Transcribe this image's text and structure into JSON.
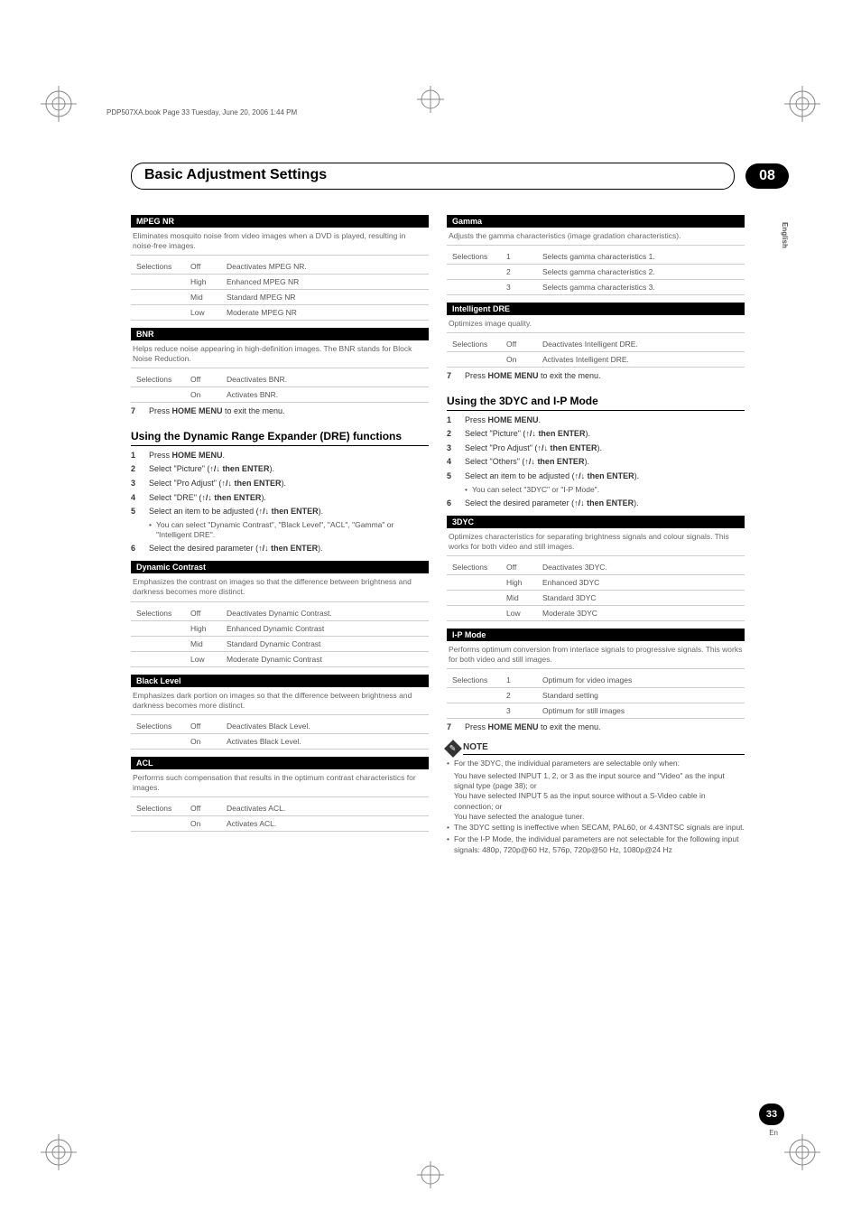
{
  "doc_header": "PDP507XA.book  Page 33  Tuesday, June 20, 2006  1:44 PM",
  "title": "Basic Adjustment Settings",
  "chapter": "08",
  "language_tab": "English",
  "page_number": "33",
  "page_lang": "En",
  "arrows": "↑/↓",
  "sections": {
    "mpeg_nr": {
      "title": "MPEG NR",
      "desc": "Eliminates mosquito noise from video images when a DVD is played, resulting in noise-free images.",
      "sel_label": "Selections",
      "rows": [
        {
          "v": "Off",
          "d": "Deactivates MPEG NR."
        },
        {
          "v": "High",
          "d": "Enhanced MPEG NR"
        },
        {
          "v": "Mid",
          "d": "Standard MPEG NR"
        },
        {
          "v": "Low",
          "d": "Moderate MPEG NR"
        }
      ]
    },
    "bnr": {
      "title": "BNR",
      "desc": "Helps reduce noise appearing in high-definition images. The BNR stands for Block Noise Reduction.",
      "sel_label": "Selections",
      "rows": [
        {
          "v": "Off",
          "d": "Deactivates BNR."
        },
        {
          "v": "On",
          "d": "Activates BNR."
        }
      ]
    },
    "exit1": {
      "num": "7",
      "pre": "Press ",
      "b": "HOME MENU",
      "post": " to exit the menu."
    },
    "dre_head": "Using the Dynamic Range Expander (DRE) functions",
    "dre_steps": [
      {
        "n": "1",
        "pre": "Press ",
        "b": "HOME MENU",
        "post": "."
      },
      {
        "n": "2",
        "pre": "Select \"Picture\" (",
        "b": " then ENTER",
        "post": ")."
      },
      {
        "n": "3",
        "pre": "Select \"Pro Adjust\" (",
        "b": " then ENTER",
        "post": ")."
      },
      {
        "n": "4",
        "pre": "Select \"DRE\" (",
        "b": " then ENTER",
        "post": ")."
      },
      {
        "n": "5",
        "pre": "Select an item to be adjusted (",
        "b": " then ENTER",
        "post": ")."
      },
      {
        "n": "6",
        "pre": "Select the desired parameter (",
        "b": " then ENTER",
        "post": ")."
      }
    ],
    "dre_step5_sub": "You can select \"Dynamic Contrast\", \"Black Level\", \"ACL\", \"Gamma\" or \"Intelligent DRE\".",
    "dyn_contrast": {
      "title": "Dynamic Contrast",
      "desc": "Emphasizes the contrast on images so that the difference between brightness and darkness becomes more distinct.",
      "sel_label": "Selections",
      "rows": [
        {
          "v": "Off",
          "d": "Deactivates Dynamic Contrast."
        },
        {
          "v": "High",
          "d": "Enhanced Dynamic Contrast"
        },
        {
          "v": "Mid",
          "d": "Standard Dynamic Contrast"
        },
        {
          "v": "Low",
          "d": "Moderate Dynamic Contrast"
        }
      ]
    },
    "black_level": {
      "title": "Black Level",
      "desc": "Emphasizes dark portion on images so that the difference between brightness and darkness becomes more distinct.",
      "sel_label": "Selections",
      "rows": [
        {
          "v": "Off",
          "d": "Deactivates Black Level."
        },
        {
          "v": "On",
          "d": "Activates Black Level."
        }
      ]
    },
    "acl": {
      "title": "ACL",
      "desc": "Performs such compensation that results in the optimum contrast characteristics for images.",
      "sel_label": "Selections",
      "rows": [
        {
          "v": "Off",
          "d": "Deactivates ACL."
        },
        {
          "v": "On",
          "d": "Activates ACL."
        }
      ]
    },
    "gamma": {
      "title": "Gamma",
      "desc": "Adjusts the gamma characteristics (image gradation characteristics).",
      "sel_label": "Selections",
      "rows": [
        {
          "v": "1",
          "d": "Selects gamma characteristics 1."
        },
        {
          "v": "2",
          "d": "Selects gamma characteristics 2."
        },
        {
          "v": "3",
          "d": "Selects gamma characteristics 3."
        }
      ]
    },
    "idre": {
      "title": "Intelligent DRE",
      "desc": "Optimizes image quality.",
      "sel_label": "Selections",
      "rows": [
        {
          "v": "Off",
          "d": "Deactivates Intelligent DRE."
        },
        {
          "v": "On",
          "d": "Activates Intelligent DRE."
        }
      ]
    },
    "exit2": {
      "num": "7",
      "pre": "Press ",
      "b": "HOME MENU",
      "post": " to exit the menu."
    },
    "ip_head": "Using the 3DYC and I-P Mode",
    "ip_steps": [
      {
        "n": "1",
        "pre": "Press ",
        "b": "HOME MENU",
        "post": "."
      },
      {
        "n": "2",
        "pre": "Select \"Picture\" (",
        "b": " then ENTER",
        "post": ")."
      },
      {
        "n": "3",
        "pre": "Select \"Pro Adjust\" (",
        "b": " then ENTER",
        "post": ")."
      },
      {
        "n": "4",
        "pre": "Select \"Others\" (",
        "b": " then ENTER",
        "post": ")."
      },
      {
        "n": "5",
        "pre": "Select an item to be adjusted (",
        "b": " then ENTER",
        "post": ")."
      },
      {
        "n": "6",
        "pre": "Select the desired parameter (",
        "b": " then ENTER",
        "post": ")."
      }
    ],
    "ip_step5_sub": "You can select \"3DYC\" or \"I-P Mode\".",
    "t3dyc": {
      "title": "3DYC",
      "desc": "Optimizes characteristics for separating brightness signals and colour signals. This works for both video and still images.",
      "sel_label": "Selections",
      "rows": [
        {
          "v": "Off",
          "d": "Deactivates 3DYC."
        },
        {
          "v": "High",
          "d": "Enhanced 3DYC"
        },
        {
          "v": "Mid",
          "d": "Standard 3DYC"
        },
        {
          "v": "Low",
          "d": "Moderate 3DYC"
        }
      ]
    },
    "ipmode": {
      "title": "I-P Mode",
      "desc": "Performs optimum conversion from interlace signals to progressive signals. This works for both video and still images.",
      "sel_label": "Selections",
      "rows": [
        {
          "v": "1",
          "d": "Optimum for video images"
        },
        {
          "v": "2",
          "d": "Standard setting"
        },
        {
          "v": "3",
          "d": "Optimum for still images"
        }
      ]
    },
    "exit3": {
      "num": "7",
      "pre": "Press ",
      "b": "HOME MENU",
      "post": " to exit the menu."
    },
    "note_label": "NOTE",
    "notes": [
      "For the 3DYC, the individual parameters are selectable only when:",
      "The 3DYC setting is ineffective when SECAM, PAL60, or 4.43NTSC signals are input.",
      "For the I-P Mode, the individual parameters are not selectable for the following input signals: 480p, 720p@60 Hz, 576p, 720p@50 Hz, 1080p@24 Hz"
    ],
    "note1_subs": [
      "You have selected INPUT 1, 2, or 3 as the input source and \"Video\" as the input signal type (page 38); or",
      "You have selected INPUT 5 as the input source without a S-Video cable in connection; or",
      "You have selected the analogue tuner."
    ]
  }
}
